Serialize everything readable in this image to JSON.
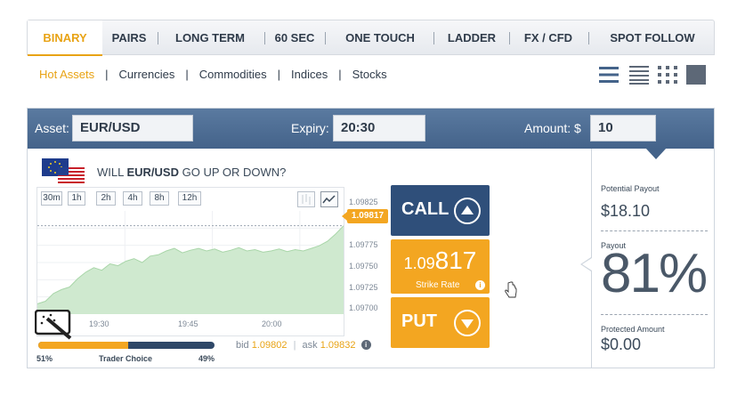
{
  "tabs": [
    {
      "label": "BINARY",
      "active": true
    },
    {
      "label": "PAIRS"
    },
    {
      "label": "LONG TERM"
    },
    {
      "label": "60 SEC"
    },
    {
      "label": "ONE TOUCH"
    },
    {
      "label": "LADDER"
    },
    {
      "label": "FX / CFD"
    },
    {
      "label": "SPOT FOLLOW"
    }
  ],
  "subnav": [
    "Hot Assets",
    "Currencies",
    "Commodities",
    "Indices",
    "Stocks"
  ],
  "view_icons": [
    "list-view-icon",
    "compact-list-view-icon",
    "grid-view-icon",
    "tile-view-icon"
  ],
  "header": {
    "asset_label": "Asset:",
    "asset_value": "EUR/USD",
    "expiry_label": "Expiry:",
    "expiry_value": "20:30",
    "amount_label": "Amount: $",
    "amount_value": "10"
  },
  "question": {
    "prefix": "WILL ",
    "asset": "EUR/USD",
    "suffix": " GO UP OR DOWN?"
  },
  "ranges": [
    "30m",
    "1h",
    "2h",
    "4h",
    "8h",
    "12h"
  ],
  "chart_data": {
    "type": "area",
    "y_ticks": [
      "1.09825",
      "1.09800",
      "1.09775",
      "1.09750",
      "1.09725",
      "1.09700"
    ],
    "x_ticks": [
      "19:30",
      "19:45",
      "20:00"
    ],
    "current_price": "1.09817",
    "ylim": [
      1.0968,
      1.0984
    ],
    "values": [
      1.09696,
      1.097,
      1.09712,
      1.09718,
      1.09722,
      1.09735,
      1.09745,
      1.09752,
      1.09748,
      1.09758,
      1.09755,
      1.09762,
      1.09766,
      1.0976,
      1.0977,
      1.09772,
      1.09778,
      1.09782,
      1.09775,
      1.09779,
      1.09782,
      1.09778,
      1.09781,
      1.09776,
      1.09779,
      1.09783,
      1.09778,
      1.0978,
      1.09776,
      1.09778,
      1.09781,
      1.09777,
      1.0978,
      1.09778,
      1.09782,
      1.09786,
      1.09793,
      1.09804,
      1.09817
    ],
    "color": "#cfe9cf"
  },
  "bid": {
    "label": "bid",
    "value": "1.09802"
  },
  "ask": {
    "label": "ask",
    "value": "1.09832"
  },
  "trader_choice": {
    "label": "Trader Choice",
    "left_pct": "51%",
    "right_pct": "49%",
    "left_fraction": 0.51
  },
  "call": {
    "label": "CALL"
  },
  "strike": {
    "prefix": "1.09",
    "big": "817",
    "label": "Strike Rate"
  },
  "put": {
    "label": "PUT"
  },
  "right": {
    "potential_label": "Potential Payout",
    "potential_value": "$18.10",
    "payout_label": "Payout",
    "payout_value": "81%",
    "protected_label": "Protected Amount",
    "protected_value": "$0.00"
  },
  "colors": {
    "accent": "#e8a315",
    "navy": "#2f4f7a",
    "orange": "#f3a621"
  }
}
